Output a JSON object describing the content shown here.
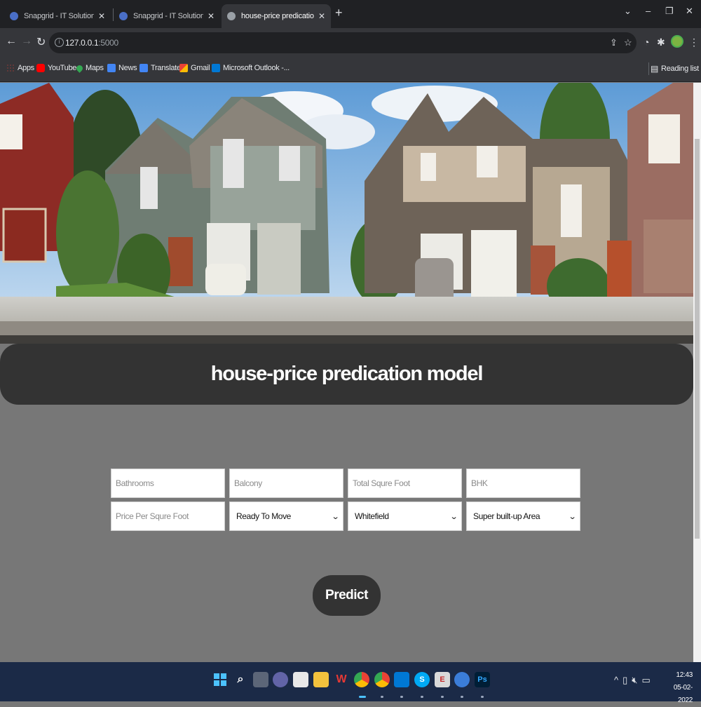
{
  "browser": {
    "tabs": [
      {
        "title": "Snapgrid - IT Solutions and Techn",
        "active": false
      },
      {
        "title": "Snapgrid - IT Solutions and Techn",
        "active": false
      },
      {
        "title": "house-price predication model",
        "active": true
      }
    ],
    "url_host": "127.0.0.1",
    "url_port": ":5000",
    "bookmarks": [
      {
        "label": "Apps",
        "color": "#ea4335"
      },
      {
        "label": "YouTube",
        "color": "#ff0000"
      },
      {
        "label": "Maps",
        "color": "#34a853"
      },
      {
        "label": "News",
        "color": "#4285f4"
      },
      {
        "label": "Translate",
        "color": "#4285f4"
      },
      {
        "label": "Gmail",
        "color": "#ea4335"
      },
      {
        "label": "Microsoft Outlook -...",
        "color": "#0078d4"
      }
    ],
    "reading_list": "Reading list"
  },
  "page": {
    "title": "house-price predication model",
    "fields": {
      "bathrooms_placeholder": "Bathrooms",
      "balcony_placeholder": "Balcony",
      "total_sqft_placeholder": "Total Squre Foot",
      "bhk_placeholder": "BHK",
      "price_per_sqft_placeholder": "Price Per Squre Foot"
    },
    "selects": {
      "availability": "Ready To Move",
      "location": "Whitefield",
      "area_type": "Super built-up Area"
    },
    "predict_label": "Predict"
  },
  "taskbar": {
    "time": "12:43",
    "date": "05-02-2022"
  },
  "colors": {
    "page_bg": "#777777",
    "banner_bg": "#333333",
    "button_bg": "#333333"
  }
}
